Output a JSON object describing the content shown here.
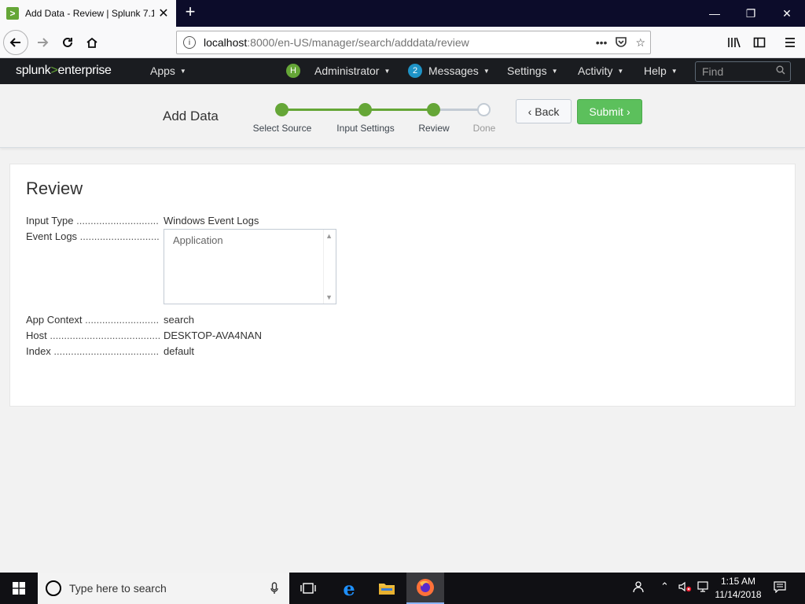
{
  "browser": {
    "tab_title": "Add Data - Review | Splunk 7.1.",
    "new_tab": "+",
    "url_host": "localhost",
    "url_rest": ":8000/en-US/manager/search/adddata/review",
    "window_controls": [
      "minimize",
      "restore",
      "close"
    ]
  },
  "splunk": {
    "brand_left": "splunk",
    "brand_gt": ">",
    "brand_right": "enterprise",
    "menu": {
      "apps": "Apps",
      "user_initial": "H",
      "user": "Administrator",
      "messages_count": "2",
      "messages": "Messages",
      "settings": "Settings",
      "activity": "Activity",
      "help": "Help"
    },
    "find_placeholder": "Find"
  },
  "wizard": {
    "title": "Add Data",
    "steps": [
      {
        "label": "Select Source",
        "state": "complete"
      },
      {
        "label": "Input Settings",
        "state": "complete"
      },
      {
        "label": "Review",
        "state": "current"
      },
      {
        "label": "Done",
        "state": "pending"
      }
    ],
    "back_label": "Back",
    "submit_label": "Submit",
    "accent_color": "#65a637"
  },
  "review": {
    "heading": "Review",
    "fields": [
      {
        "label": "Input Type",
        "value": "Windows Event Logs"
      },
      {
        "label": "Event Logs",
        "value": ""
      },
      {
        "label": "App Context",
        "value": "search"
      },
      {
        "label": "Host",
        "value": "DESKTOP-AVA4NAN"
      },
      {
        "label": "Index",
        "value": "default"
      }
    ],
    "event_logs": [
      "Application"
    ]
  },
  "taskbar": {
    "search_placeholder": "Type here to search",
    "time": "1:15 AM",
    "date": "11/14/2018"
  }
}
